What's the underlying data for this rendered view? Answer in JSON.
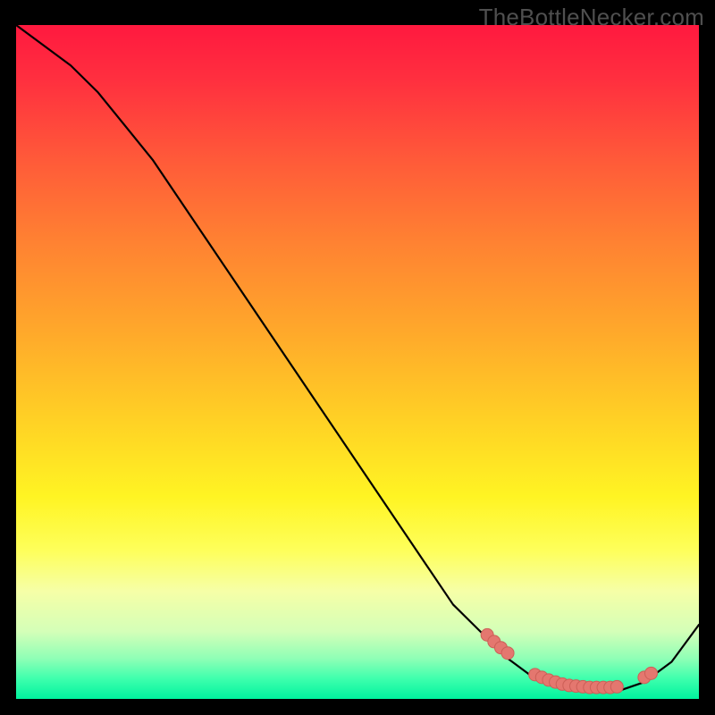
{
  "watermark": "TheBottleNecker.com",
  "colors": {
    "curve": "#000000",
    "dot_fill": "#e4776f",
    "dot_stroke": "#cc5f57"
  },
  "chart_data": {
    "type": "line",
    "title": "",
    "xlabel": "",
    "ylabel": "",
    "xlim": [
      0,
      100
    ],
    "ylim": [
      0,
      100
    ],
    "curve_x": [
      0,
      4,
      8,
      12,
      16,
      20,
      24,
      28,
      32,
      36,
      40,
      44,
      48,
      52,
      56,
      60,
      64,
      68,
      72,
      76,
      80,
      84,
      88,
      92,
      96,
      100
    ],
    "curve_y": [
      100,
      97,
      94,
      90,
      85,
      80,
      74,
      68,
      62,
      56,
      50,
      44,
      38,
      32,
      26,
      20,
      14,
      10,
      6,
      3,
      1.5,
      1.1,
      1.1,
      2.5,
      5.5,
      11
    ],
    "dots_x": [
      69,
      70,
      71,
      72,
      76,
      77,
      78,
      79,
      80,
      81,
      82,
      83,
      84,
      85,
      86,
      87,
      88,
      92,
      93
    ],
    "dots_y": [
      9.5,
      8.5,
      7.6,
      6.8,
      3.6,
      3.2,
      2.8,
      2.5,
      2.2,
      2.0,
      1.9,
      1.8,
      1.7,
      1.7,
      1.7,
      1.7,
      1.8,
      3.2,
      3.8
    ]
  }
}
